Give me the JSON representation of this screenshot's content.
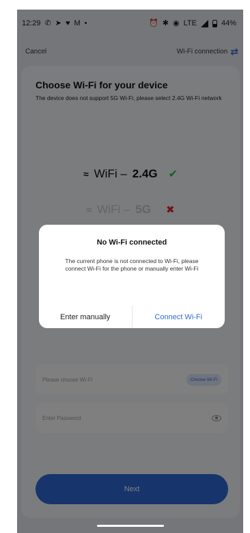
{
  "status_bar": {
    "time": "12:29",
    "battery": "44%",
    "network": "LTE",
    "battery_level": 0.44,
    "left_icons": [
      "whatsapp-icon",
      "telegram-icon",
      "chat-icon",
      "gmail-icon",
      "dot-icon"
    ],
    "right_icons": [
      "alarm-icon",
      "bluetooth-icon",
      "location-icon",
      "volte-icon",
      "signal-icon",
      "battery-icon"
    ]
  },
  "topbar": {
    "cancel_label": "Cancel",
    "wifi_connection_label": "Wi-Fi connection",
    "icon": "swap-arrows-icon"
  },
  "main": {
    "title": "Choose Wi-Fi for your device",
    "subtitle": "The device does not support 5G Wi-Fi, please select 2.4G Wi-Fi network",
    "band_24": {
      "prefix": "WiFi –",
      "freq": "2.4G",
      "icon": "check-icon"
    },
    "band_5": {
      "prefix": "WiFi –",
      "freq": "5G",
      "icon": "cross-icon"
    },
    "wifi_field": {
      "placeholder": "Please choose Wi-Fi",
      "button_label": "Choose Wi-Fi"
    },
    "password_field": {
      "placeholder": "Enter Password",
      "icon": "eye-icon"
    },
    "next_label": "Next"
  },
  "dialog": {
    "title": "No Wi-Fi connected",
    "message": "The current phone is not connected to Wi-Fi, please connect Wi-Fi for the phone or manually enter Wi-Fi",
    "enter_manually_label": "Enter manually",
    "connect_label": "Connect Wi-Fi"
  },
  "colors": {
    "accent": "#2f6bd8",
    "check": "#27c04f",
    "cross": "#e0282f",
    "background": "#ebedf2"
  }
}
